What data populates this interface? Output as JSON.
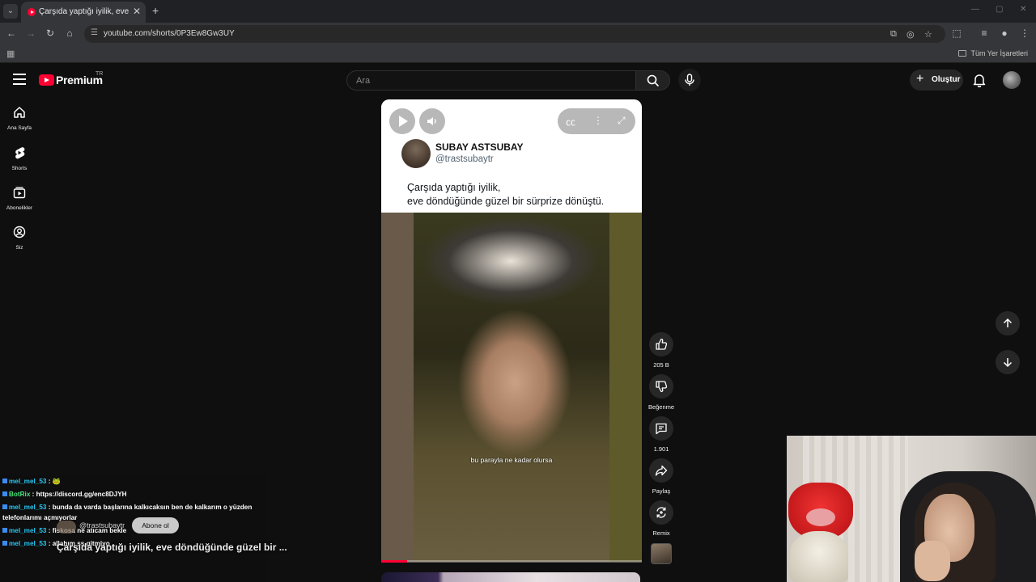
{
  "browser": {
    "tab_title": "Çarşıda yaptığı iyilik, eve döndü",
    "url": "youtube.com/shorts/0P3Ew8Gw3UY",
    "bookmarks_all": "Tüm Yer İşaretleri"
  },
  "header": {
    "logo_word": "Premium",
    "country": "TR",
    "search_placeholder": "Ara",
    "create_label": "Oluştur"
  },
  "sidebar": {
    "items": [
      {
        "label": "Ana Sayfa",
        "icon": "home-icon"
      },
      {
        "label": "Shorts",
        "icon": "shorts-icon"
      },
      {
        "label": "Abonelikler",
        "icon": "subscriptions-icon"
      },
      {
        "label": "Siz",
        "icon": "you-icon"
      }
    ]
  },
  "short": {
    "account_name": "SUBAY ASTSUBAY",
    "account_handle": "@trastsubaytr",
    "tweet_line1": "Çarşıda yaptığı iyilik,",
    "tweet_line2": "eve döndüğünde güzel bir sürprize dönüştü.",
    "caption": "bu parayla ne kadar olursa",
    "progress": 0.1,
    "title": "Çarşıda yaptığı iyilik, eve döndüğünde güzel bir ...",
    "channel_handle": "@trastsubaytr",
    "subscribe_label": "Abone ol"
  },
  "actions": {
    "like_count": "205 B",
    "dislike_label": "Beğenme",
    "comment_count": "1.901",
    "share_label": "Paylaş",
    "remix_label": "Remix"
  },
  "chat": [
    {
      "user": "mel_mel_53",
      "sep": " :",
      "msg": " 🐸"
    },
    {
      "user": "BotRix",
      "sep": " :",
      "msg": " https://discord.gg/enc8DJYH"
    },
    {
      "user": "mel_mel_53",
      "sep": " :",
      "msg": " bunda da varda başlarına kalkıcaksın ben de kalkarım o yüzden telefonlarımı açmıyorlar"
    },
    {
      "user": "mel_mel_53",
      "sep": " :",
      "msg": " fiskosa ne atıcam bekle"
    },
    {
      "user": "mel_mel_53",
      "sep": " :",
      "msg": " allahım ss gitmiyo"
    }
  ]
}
